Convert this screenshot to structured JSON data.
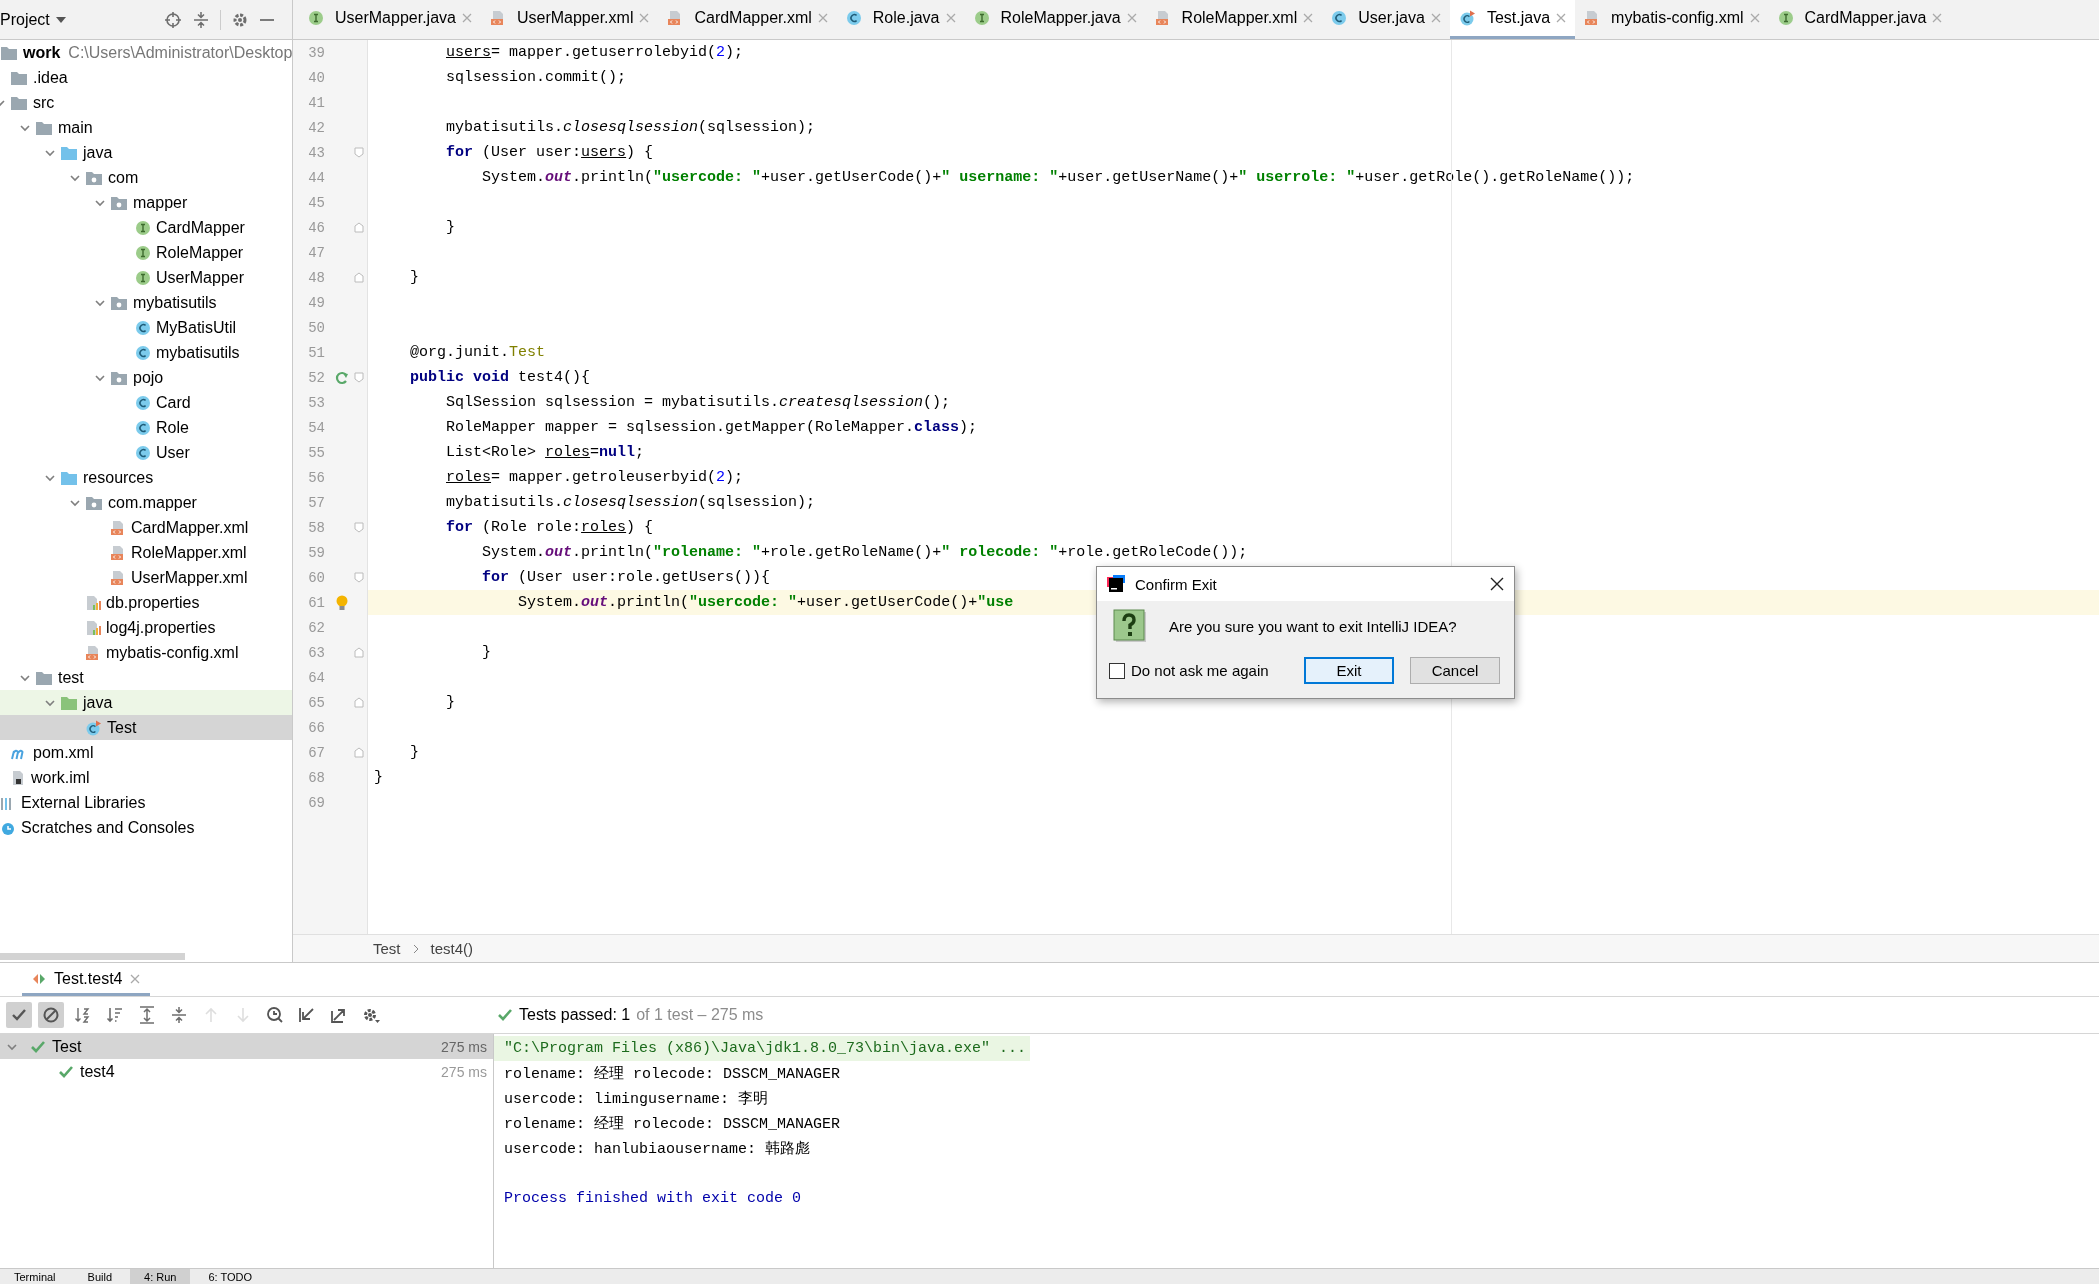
{
  "project_panel": {
    "title": "Project",
    "tree": [
      {
        "label": "work",
        "path": "C:\\Users\\Administrator\\Desktop",
        "kind": "module",
        "selected": false,
        "children": [
          {
            "label": ".idea",
            "kind": "folder",
            "selected": false
          },
          {
            "label": "src",
            "kind": "folder",
            "selected": false,
            "expanded": true,
            "children": [
              {
                "label": "main",
                "kind": "folder",
                "selected": false,
                "expanded": true,
                "children": [
                  {
                    "label": "java",
                    "kind": "source",
                    "selected": false,
                    "expanded": true,
                    "children": [
                      {
                        "label": "com",
                        "kind": "package",
                        "selected": false,
                        "expanded": true,
                        "children": [
                          {
                            "label": "mapper",
                            "kind": "package",
                            "selected": false,
                            "expanded": true,
                            "children": [
                              {
                                "label": "CardMapper",
                                "kind": "interface",
                                "selected": false
                              },
                              {
                                "label": "RoleMapper",
                                "kind": "interface",
                                "selected": false
                              },
                              {
                                "label": "UserMapper",
                                "kind": "interface",
                                "selected": false
                              }
                            ]
                          },
                          {
                            "label": "mybatisutils",
                            "kind": "package",
                            "selected": false,
                            "expanded": true,
                            "children": [
                              {
                                "label": "MyBatisUtil",
                                "kind": "class",
                                "selected": false
                              },
                              {
                                "label": "mybatisutils",
                                "kind": "class",
                                "selected": false
                              }
                            ]
                          },
                          {
                            "label": "pojo",
                            "kind": "package",
                            "selected": false,
                            "expanded": true,
                            "children": [
                              {
                                "label": "Card",
                                "kind": "class",
                                "selected": false
                              },
                              {
                                "label": "Role",
                                "kind": "class",
                                "selected": false
                              },
                              {
                                "label": "User",
                                "kind": "class",
                                "selected": false
                              }
                            ]
                          }
                        ]
                      }
                    ]
                  },
                  {
                    "label": "resources",
                    "kind": "source",
                    "selected": false,
                    "expanded": true,
                    "children": [
                      {
                        "label": "com.mapper",
                        "kind": "package",
                        "selected": false,
                        "expanded": true,
                        "children": [
                          {
                            "label": "CardMapper.xml",
                            "kind": "xml",
                            "selected": false
                          },
                          {
                            "label": "RoleMapper.xml",
                            "kind": "xml",
                            "selected": false
                          },
                          {
                            "label": "UserMapper.xml",
                            "kind": "xml",
                            "selected": false
                          }
                        ]
                      },
                      {
                        "label": "db.properties",
                        "kind": "properties",
                        "selected": false
                      },
                      {
                        "label": "log4j.properties",
                        "kind": "properties",
                        "selected": false
                      },
                      {
                        "label": "mybatis-config.xml",
                        "kind": "xml",
                        "selected": false
                      }
                    ]
                  }
                ]
              },
              {
                "label": "test",
                "kind": "folder",
                "selected": false,
                "expanded": true,
                "children": [
                  {
                    "label": "java",
                    "kind": "test-root",
                    "selected": false,
                    "expanded": true,
                    "children": [
                      {
                        "label": "Test",
                        "kind": "test-class",
                        "selected": true
                      }
                    ]
                  }
                ]
              }
            ]
          },
          {
            "label": "pom.xml",
            "kind": "maven",
            "selected": false
          },
          {
            "label": "work.iml",
            "kind": "iml",
            "selected": false
          }
        ]
      },
      {
        "label": "External Libraries",
        "kind": "libraries",
        "selected": false
      },
      {
        "label": "Scratches and Consoles",
        "kind": "scratches",
        "selected": false
      }
    ]
  },
  "editor_tabs": [
    {
      "label": "UserMapper.java",
      "kind": "interface",
      "selected": false
    },
    {
      "label": "UserMapper.xml",
      "kind": "xml",
      "selected": false
    },
    {
      "label": "CardMapper.xml",
      "kind": "xml",
      "selected": false
    },
    {
      "label": "Role.java",
      "kind": "class",
      "selected": false
    },
    {
      "label": "RoleMapper.java",
      "kind": "interface",
      "selected": false
    },
    {
      "label": "RoleMapper.xml",
      "kind": "xml",
      "selected": false
    },
    {
      "label": "User.java",
      "kind": "class",
      "selected": false
    },
    {
      "label": "Test.java",
      "kind": "test-class",
      "selected": true
    },
    {
      "label": "mybatis-config.xml",
      "kind": "xml",
      "selected": false
    },
    {
      "label": "CardMapper.java",
      "kind": "interface",
      "selected": false
    }
  ],
  "editor": {
    "lines": [
      {
        "number": "39",
        "highlighted": false,
        "tokens": [
          {
            "text": "        users",
            "kind": "var"
          },
          {
            "text": "= mapper.getuserrolebyid(",
            "kind": "plain"
          },
          {
            "text": "2",
            "kind": "number"
          },
          {
            "text": ");",
            "kind": "plain"
          }
        ]
      },
      {
        "number": "40",
        "highlighted": false,
        "tokens": [
          {
            "text": "        sqlsession.commit();",
            "kind": "plain"
          }
        ]
      },
      {
        "number": "41",
        "highlighted": false
      },
      {
        "number": "42",
        "highlighted": false,
        "tokens": [
          {
            "text": "        mybatisutils.",
            "kind": "plain"
          },
          {
            "text": "closesqlsession",
            "kind": "static"
          },
          {
            "text": "(sqlsession);",
            "kind": "plain"
          }
        ]
      },
      {
        "number": "43",
        "highlighted": false,
        "gutter": [
          {
            "kind": "fold-start"
          }
        ],
        "tokens": [
          {
            "text": "        for",
            "kind": "keyword"
          },
          {
            "text": " (User user:",
            "kind": "plain"
          },
          {
            "text": "users",
            "kind": "var"
          },
          {
            "text": ") {",
            "kind": "plain"
          }
        ]
      },
      {
        "number": "44",
        "highlighted": false,
        "tokens": [
          {
            "text": "            System.",
            "kind": "plain"
          },
          {
            "text": "out",
            "kind": "field"
          },
          {
            "text": ".println(",
            "kind": "plain"
          },
          {
            "text": "\"usercode: \"",
            "kind": "string"
          },
          {
            "text": "+user.getUserCode()+",
            "kind": "plain"
          },
          {
            "text": "\" username: \"",
            "kind": "string"
          },
          {
            "text": "+user.getUserName()+",
            "kind": "plain"
          },
          {
            "text": "\" userrole: \"",
            "kind": "string"
          },
          {
            "text": "+user.getRole().getRoleName());",
            "kind": "plain"
          }
        ]
      },
      {
        "number": "45",
        "highlighted": false
      },
      {
        "number": "46",
        "highlighted": false,
        "gutter": [
          {
            "kind": "fold-end"
          }
        ],
        "tokens": [
          {
            "text": "        }",
            "kind": "plain"
          }
        ]
      },
      {
        "number": "47",
        "highlighted": false
      },
      {
        "number": "48",
        "highlighted": false,
        "gutter": [
          {
            "kind": "fold-end"
          }
        ],
        "tokens": [
          {
            "text": "    }",
            "kind": "plain"
          }
        ]
      },
      {
        "number": "49",
        "highlighted": false
      },
      {
        "number": "50",
        "highlighted": false
      },
      {
        "number": "51",
        "highlighted": false,
        "tokens": [
          {
            "text": "    @org.junit.",
            "kind": "plain"
          },
          {
            "text": "Test",
            "kind": "annotation"
          }
        ]
      },
      {
        "number": "52",
        "highlighted": false,
        "gutter": [
          {
            "kind": "run"
          },
          {
            "kind": "fold-start"
          }
        ],
        "tokens": [
          {
            "text": "    public void",
            "kind": "keyword"
          },
          {
            "text": " test4(){",
            "kind": "plain"
          }
        ]
      },
      {
        "number": "53",
        "highlighted": false,
        "tokens": [
          {
            "text": "        SqlSession sqlsession = mybatisutils.",
            "kind": "plain"
          },
          {
            "text": "createsqlsession",
            "kind": "static"
          },
          {
            "text": "();",
            "kind": "plain"
          }
        ]
      },
      {
        "number": "54",
        "highlighted": false,
        "tokens": [
          {
            "text": "        RoleMapper mapper = sqlsession.getMapper(RoleMapper.",
            "kind": "plain"
          },
          {
            "text": "class",
            "kind": "keyword"
          },
          {
            "text": ");",
            "kind": "plain"
          }
        ]
      },
      {
        "number": "55",
        "highlighted": false,
        "tokens": [
          {
            "text": "        List<Role> ",
            "kind": "plain"
          },
          {
            "text": "roles",
            "kind": "var"
          },
          {
            "text": "=",
            "kind": "plain"
          },
          {
            "text": "null",
            "kind": "keyword"
          },
          {
            "text": ";",
            "kind": "plain"
          }
        ]
      },
      {
        "number": "56",
        "highlighted": false,
        "tokens": [
          {
            "text": "        roles",
            "kind": "var"
          },
          {
            "text": "= mapper.getroleuserbyid(",
            "kind": "plain"
          },
          {
            "text": "2",
            "kind": "number"
          },
          {
            "text": ");",
            "kind": "plain"
          }
        ]
      },
      {
        "number": "57",
        "highlighted": false,
        "tokens": [
          {
            "text": "        mybatisutils.",
            "kind": "plain"
          },
          {
            "text": "closesqlsession",
            "kind": "static"
          },
          {
            "text": "(sqlsession);",
            "kind": "plain"
          }
        ]
      },
      {
        "number": "58",
        "highlighted": false,
        "gutter": [
          {
            "kind": "fold-start"
          }
        ],
        "tokens": [
          {
            "text": "        for",
            "kind": "keyword"
          },
          {
            "text": " (Role role:",
            "kind": "plain"
          },
          {
            "text": "roles",
            "kind": "var"
          },
          {
            "text": ") {",
            "kind": "plain"
          }
        ]
      },
      {
        "number": "59",
        "highlighted": false,
        "tokens": [
          {
            "text": "            System.",
            "kind": "plain"
          },
          {
            "text": "out",
            "kind": "field"
          },
          {
            "text": ".println(",
            "kind": "plain"
          },
          {
            "text": "\"rolename: \"",
            "kind": "string"
          },
          {
            "text": "+role.getRoleName()+",
            "kind": "plain"
          },
          {
            "text": "\" rolecode: \"",
            "kind": "string"
          },
          {
            "text": "+role.getRoleCode());",
            "kind": "plain"
          }
        ]
      },
      {
        "number": "60",
        "highlighted": false,
        "gutter": [
          {
            "kind": "fold-start"
          }
        ],
        "tokens": [
          {
            "text": "            for",
            "kind": "keyword"
          },
          {
            "text": " (User user:role.getUsers()){",
            "kind": "plain"
          }
        ]
      },
      {
        "number": "61",
        "highlighted": true,
        "gutter": [
          {
            "kind": "bulb"
          }
        ],
        "tokens": [
          {
            "text": "                System.",
            "kind": "plain"
          },
          {
            "text": "out",
            "kind": "field"
          },
          {
            "text": ".println(",
            "kind": "plain"
          },
          {
            "text": "\"usercode: \"",
            "kind": "string"
          },
          {
            "text": "+user.getUserCode()+",
            "kind": "plain"
          },
          {
            "text": "\"use",
            "kind": "string"
          }
        ]
      },
      {
        "number": "62",
        "highlighted": false
      },
      {
        "number": "63",
        "highlighted": false,
        "gutter": [
          {
            "kind": "fold-end"
          }
        ],
        "tokens": [
          {
            "text": "            }",
            "kind": "plain"
          }
        ]
      },
      {
        "number": "64",
        "highlighted": false
      },
      {
        "number": "65",
        "highlighted": false,
        "gutter": [
          {
            "kind": "fold-end"
          }
        ],
        "tokens": [
          {
            "text": "        }",
            "kind": "plain"
          }
        ]
      },
      {
        "number": "66",
        "highlighted": false
      },
      {
        "number": "67",
        "highlighted": false,
        "gutter": [
          {
            "kind": "fold-end"
          }
        ],
        "tokens": [
          {
            "text": "    }",
            "kind": "plain"
          }
        ]
      },
      {
        "number": "68",
        "highlighted": false,
        "tokens": [
          {
            "text": "}",
            "kind": "plain"
          }
        ]
      },
      {
        "number": "69",
        "highlighted": false
      }
    ]
  },
  "breadcrumbs": [
    "Test",
    "test4()"
  ],
  "dialog": {
    "title": "Confirm Exit",
    "message": "Are you sure you want to exit IntelliJ IDEA?",
    "checkbox": {
      "label": "Do not ask me again",
      "checked": false
    },
    "buttons": [
      {
        "label": "Exit",
        "default": true
      },
      {
        "label": "Cancel",
        "default": false
      }
    ]
  },
  "run_panel": {
    "tab": "Test.test4",
    "toolbar": [
      {
        "kind": "passed",
        "pressed": true,
        "disabled": false
      },
      {
        "kind": "ignored",
        "pressed": true,
        "disabled": false
      },
      {
        "kind": "sort-alpha",
        "pressed": false,
        "disabled": false
      },
      {
        "kind": "sort-duration",
        "pressed": false,
        "disabled": false
      },
      {
        "kind": "expand",
        "pressed": false,
        "disabled": false
      },
      {
        "kind": "collapse",
        "pressed": false,
        "disabled": false
      },
      {
        "kind": "up",
        "pressed": false,
        "disabled": true
      },
      {
        "kind": "down",
        "pressed": false,
        "disabled": true
      },
      {
        "kind": "history",
        "pressed": false,
        "disabled": false
      },
      {
        "kind": "import",
        "pressed": false,
        "disabled": false
      },
      {
        "kind": "export",
        "pressed": false,
        "disabled": false
      },
      {
        "kind": "settings",
        "pressed": false,
        "disabled": false
      }
    ],
    "status": "Tests passed: 1",
    "status_detail": "of 1 test – 275 ms",
    "tests": [
      {
        "name": "Test",
        "time": "275 ms",
        "passed": true,
        "selected": true,
        "expanded": true,
        "children": [
          {
            "name": "test4",
            "time": "275 ms",
            "passed": true,
            "selected": false
          }
        ]
      }
    ],
    "console": [
      {
        "text": "\"C:\\Program Files (x86)\\Java\\jdk1.8.0_73\\bin\\java.exe\" ...",
        "kind": "command"
      },
      {
        "text": "rolename: 经理 rolecode: DSSCM_MANAGER",
        "kind": "output"
      },
      {
        "text": "usercode: limingusername: 李明",
        "kind": "output"
      },
      {
        "text": "rolename: 经理 rolecode: DSSCM_MANAGER",
        "kind": "output"
      },
      {
        "text": "usercode: hanlubiaousername: 韩路彪",
        "kind": "output"
      },
      {
        "text": "Process finished with exit code 0",
        "kind": "exit"
      }
    ]
  },
  "tool_tabs": [
    {
      "label": "Terminal",
      "selected": false
    },
    {
      "label": "Build",
      "selected": false
    },
    {
      "label": "4: Run",
      "selected": true
    },
    {
      "label": "6: TODO",
      "selected": false
    }
  ]
}
